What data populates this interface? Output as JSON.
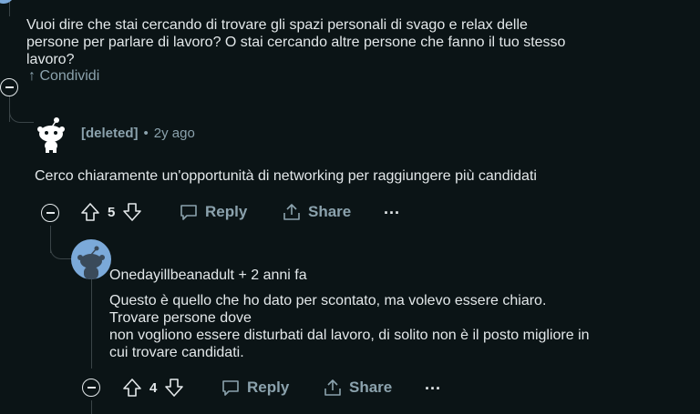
{
  "parent_comment": {
    "text_lines": [
      "Vuoi dire che stai cercando di trovare gli spazi personali di svago e relax delle",
      "persone per parlare di lavoro? O stai cercando altre persone che fanno il tuo stesso",
      "lavoro?"
    ],
    "share_label": "↑ Condividi"
  },
  "comment1": {
    "author": "[deleted]",
    "separator": "•",
    "time": "2y ago",
    "text": "Cerco chiaramente un'opportunità di networking per raggiungere più candidati",
    "votes": "5",
    "reply_label": "Reply",
    "share_label": "Share",
    "more_label": "···"
  },
  "comment2": {
    "author_line": "Onedayillbeanadult + 2 anni fa",
    "text_lines": [
      "Questo è quello che ho dato per scontato, ma volevo essere chiaro.",
      "Trovare persone dove",
      "non vogliono essere disturbati dal lavoro, di solito non è il posto migliore in",
      "cui trovare candidati."
    ],
    "votes": "4",
    "reply_label": "Reply",
    "share_label": "Share",
    "more_label": "···"
  },
  "colors": {
    "background": "#0b1416",
    "text": "#e3e8ea",
    "muted": "#8ba2ad",
    "avatar_blue": "#7ba9d9"
  }
}
